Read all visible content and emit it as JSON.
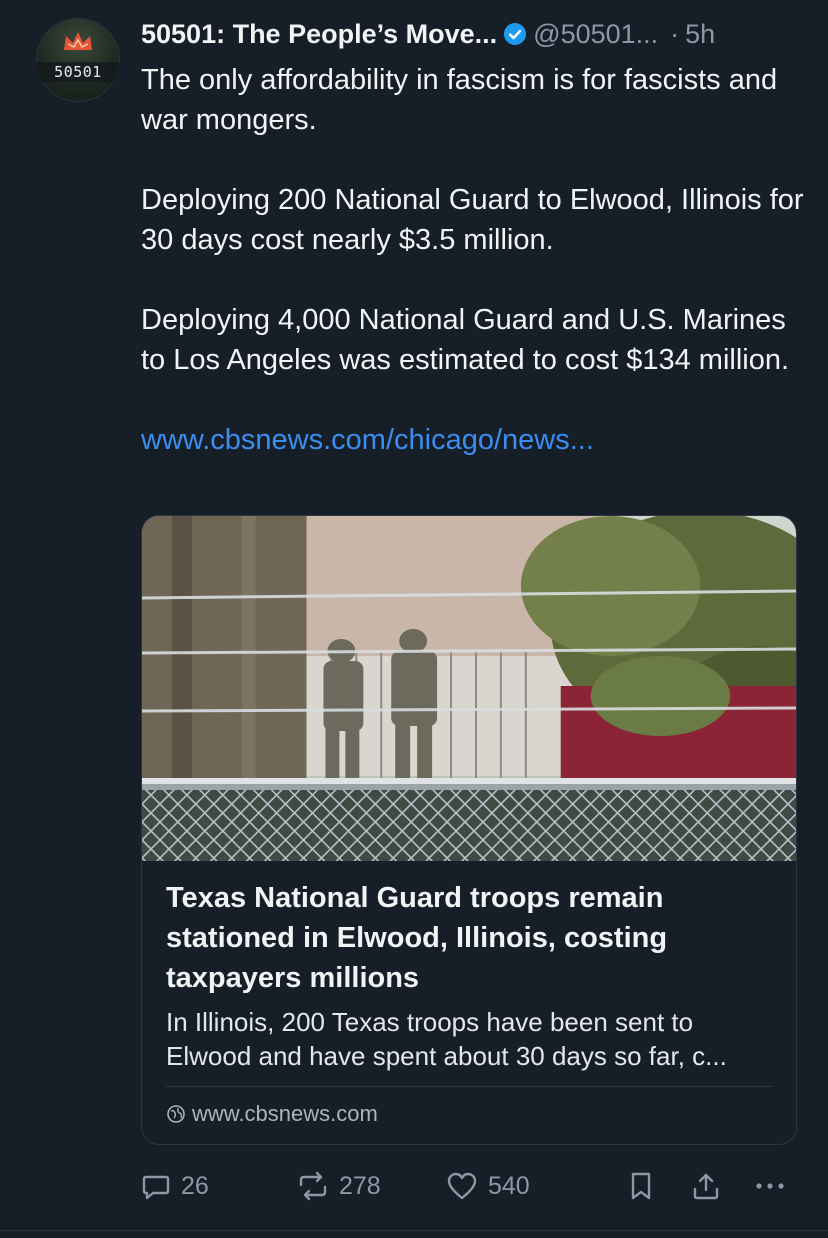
{
  "avatar": {
    "text": "50501"
  },
  "header": {
    "display_name": "50501: The People’s Move...",
    "handle": "@50501...",
    "separator": "·",
    "time": "5h"
  },
  "body": {
    "paragraphs": [
      "The only affordability in fascism is for fascists and war mongers.",
      "Deploying 200 National Guard to Elwood, Illinois for 30 days cost nearly $3.5 million.",
      "Deploying 4,000 National Guard and U.S. Marines to Los Angeles was estimated to cost $134 million."
    ],
    "link": "www.cbsnews.com/chicago/news..."
  },
  "card": {
    "title": "Texas National Guard troops remain stationed in Elwood, Illinois, costing taxpayers millions",
    "description": "In Illinois, 200 Texas troops have been sent to Elwood and have spent about 30 days so far, c...",
    "domain": "www.cbsnews.com"
  },
  "actions": {
    "replies": "26",
    "reposts": "278",
    "likes": "540"
  },
  "colors": {
    "background": "#161e27",
    "link": "#3b8ef0",
    "verified": "#1d9bf0",
    "muted": "#8b98a5"
  }
}
